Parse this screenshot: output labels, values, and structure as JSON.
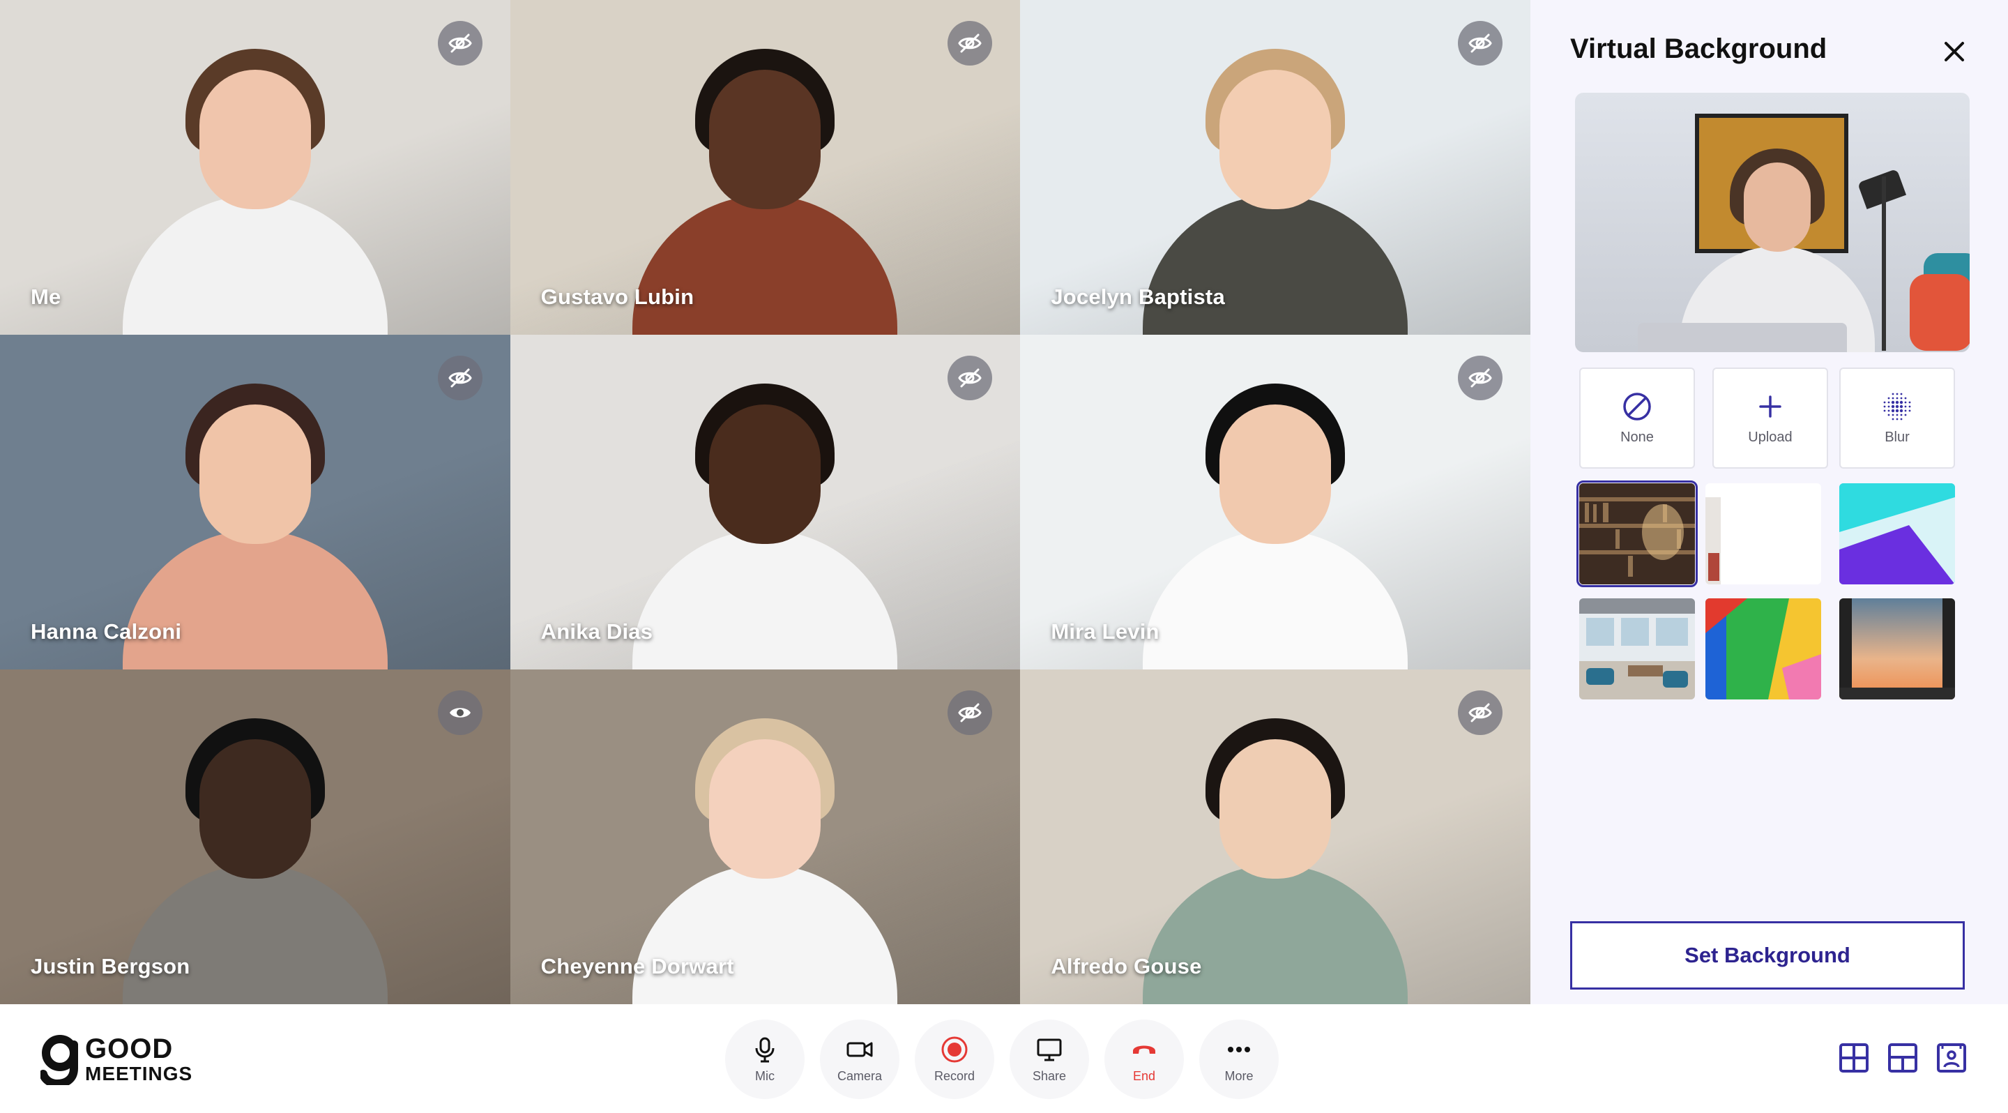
{
  "participants": [
    {
      "name": "Me",
      "visibility": "hidden",
      "bg": "#dedbd6",
      "torso": "#f2f2f2",
      "skin": "#f0c5ac",
      "hair": "#5a3b28"
    },
    {
      "name": "Gustavo Lubin",
      "visibility": "hidden",
      "bg": "#d9d2c6",
      "torso": "#8a3f2a",
      "skin": "#5a3524",
      "hair": "#1b1410"
    },
    {
      "name": "Jocelyn Baptista",
      "visibility": "hidden",
      "bg": "#e6ebee",
      "torso": "#4a4a44",
      "skin": "#f3cdb2",
      "hair": "#caa57a"
    },
    {
      "name": "Hanna Calzoni",
      "visibility": "hidden",
      "bg": "#6f7f8f",
      "torso": "#e3a48c",
      "skin": "#f0c4a8",
      "hair": "#3b2520"
    },
    {
      "name": "Anika Dias",
      "visibility": "hidden",
      "bg": "#e2e0dd",
      "torso": "#f4f4f4",
      "skin": "#4a2c1d",
      "hair": "#1a120e"
    },
    {
      "name": "Mira Levin",
      "visibility": "hidden",
      "bg": "#eef1f2",
      "torso": "#fafafa",
      "skin": "#f1c9ae",
      "hair": "#101010"
    },
    {
      "name": "Justin Bergson",
      "visibility": "visible",
      "bg": "#8a7c6e",
      "torso": "#7e7b76",
      "skin": "#3e2a20",
      "hair": "#111"
    },
    {
      "name": "Cheyenne Dorwart",
      "visibility": "hidden",
      "bg": "#9a8f82",
      "torso": "#f5f5f5",
      "skin": "#f4d1bd",
      "hair": "#d9c2a2"
    },
    {
      "name": "Alfredo Gouse",
      "visibility": "hidden",
      "bg": "#d8d1c6",
      "torso": "#8fa79a",
      "skin": "#efcdb3",
      "hair": "#1b1512"
    }
  ],
  "panel": {
    "title": "Virtual Background",
    "close_icon": "close-icon",
    "options": [
      {
        "label": "None",
        "icon": "none-icon"
      },
      {
        "label": "Upload",
        "icon": "plus-icon"
      },
      {
        "label": "Blur",
        "icon": "blur-icon"
      }
    ],
    "backgrounds": [
      {
        "name": "library",
        "selected": true
      },
      {
        "name": "room-interior",
        "selected": false
      },
      {
        "name": "abstract-cyan-purple",
        "selected": false
      },
      {
        "name": "office-lounge",
        "selected": false
      },
      {
        "name": "colorful-wall",
        "selected": false
      },
      {
        "name": "sunset-window",
        "selected": false
      }
    ],
    "set_button": "Set Background"
  },
  "brand": {
    "line1": "GOOD",
    "line2": "MEETINGS"
  },
  "controls": [
    {
      "label": "Mic",
      "icon": "mic-icon"
    },
    {
      "label": "Camera",
      "icon": "camera-icon"
    },
    {
      "label": "Record",
      "icon": "record-icon"
    },
    {
      "label": "Share",
      "icon": "share-screen-icon"
    },
    {
      "label": "End",
      "icon": "end-call-icon"
    },
    {
      "label": "More",
      "icon": "more-icon"
    }
  ],
  "colors": {
    "accent": "#3730a3",
    "end": "#e53935",
    "record": "#e53935",
    "panel_bg": "#f6f5fd"
  }
}
